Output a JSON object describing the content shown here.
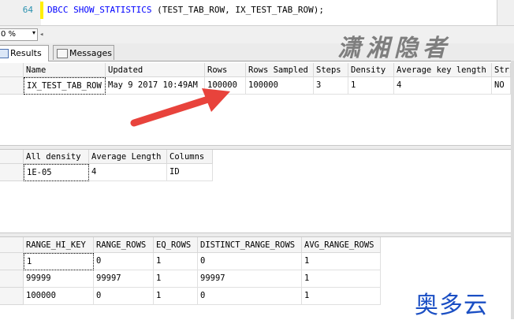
{
  "editor": {
    "line_number": "64",
    "code_keyword": "DBCC SHOW_STATISTICS",
    "code_args": " (TEST_TAB_ROW, IX_TEST_TAB_ROW);"
  },
  "zoom": {
    "value": "0 %",
    "dropdown": "▾"
  },
  "tabs": {
    "results": "Results",
    "messages": "Messages"
  },
  "watermark": {
    "top": "潇湘隐者",
    "bottom": "奥多云"
  },
  "header_grid": {
    "columns": [
      "Name",
      "Updated",
      "Rows",
      "Rows Sampled",
      "Steps",
      "Density",
      "Average key length",
      "Stri"
    ],
    "row": [
      "IX_TEST_TAB_ROW",
      "May  9 2017 10:49AM",
      "100000",
      "100000",
      "3",
      "1",
      "4",
      "NO"
    ]
  },
  "density_grid": {
    "columns": [
      "All density",
      "Average Length",
      "Columns"
    ],
    "row": [
      "1E-05",
      "4",
      "ID"
    ]
  },
  "histogram_grid": {
    "columns": [
      "RANGE_HI_KEY",
      "RANGE_ROWS",
      "EQ_ROWS",
      "DISTINCT_RANGE_ROWS",
      "AVG_RANGE_ROWS"
    ],
    "rows": [
      [
        "1",
        "0",
        "1",
        "0",
        "1"
      ],
      [
        "99999",
        "99997",
        "1",
        "99997",
        "1"
      ],
      [
        "100000",
        "0",
        "1",
        "0",
        "1"
      ]
    ]
  },
  "colors": {
    "arrow": "#e8433c",
    "keyword": "#0000ff",
    "watermark_bottom": "#1b4fc4"
  }
}
